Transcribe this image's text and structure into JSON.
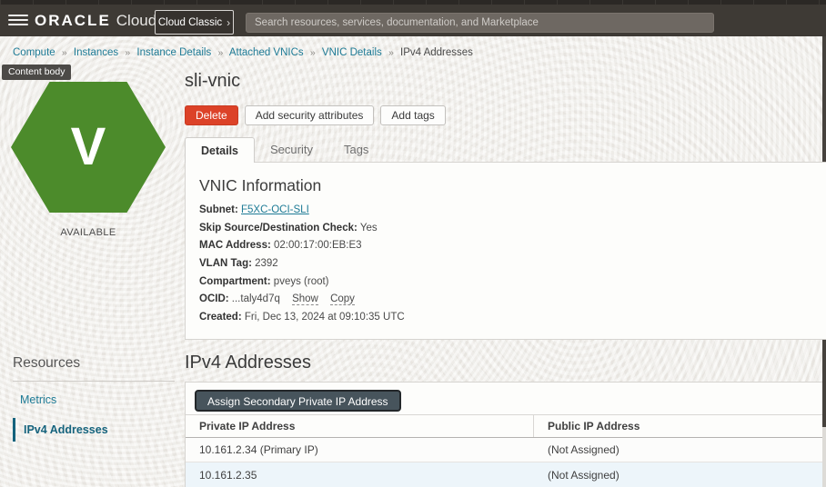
{
  "topbar": {
    "logo_oracle": "ORACLE",
    "logo_cloud": "Cloud",
    "classic_button": "Cloud Classic",
    "classic_chevron": "›",
    "search_placeholder": "Search resources, services, documentation, and Marketplace"
  },
  "breadcrumb": {
    "separator": "»",
    "items": [
      {
        "label": "Compute"
      },
      {
        "label": "Instances"
      },
      {
        "label": "Instance Details"
      },
      {
        "label": "Attached VNICs"
      },
      {
        "label": "VNIC Details"
      },
      {
        "label": "IPv4 Addresses"
      }
    ]
  },
  "tooltip": "Content body",
  "status": {
    "icon_letter": "V",
    "label": "AVAILABLE"
  },
  "page": {
    "title": "sli-vnic"
  },
  "actions": {
    "delete": "Delete",
    "add_security": "Add security attributes",
    "add_tags": "Add tags"
  },
  "tabs": [
    {
      "label": "Details"
    },
    {
      "label": "Security"
    },
    {
      "label": "Tags"
    }
  ],
  "vnic_info": {
    "heading": "VNIC Information",
    "fields": [
      {
        "label": "Subnet:",
        "value": "F5XC-OCI-SLI"
      },
      {
        "label": "Skip Source/Destination Check:",
        "value": "Yes"
      },
      {
        "label": "MAC Address:",
        "value": "02:00:17:00:EB:E3"
      },
      {
        "label": "VLAN Tag:",
        "value": "2392"
      },
      {
        "label": "Compartment:",
        "value": "pveys (root)"
      },
      {
        "label": "OCID:",
        "value": "...taly4d7q",
        "links": [
          "Show",
          "Copy"
        ]
      },
      {
        "label": "Created:",
        "value": "Fri, Dec 13, 2024 at 09:10:35 UTC"
      }
    ]
  },
  "resources": {
    "heading": "Resources",
    "items": [
      {
        "label": "Metrics"
      },
      {
        "label": "IPv4 Addresses"
      }
    ]
  },
  "ipv4": {
    "heading": "IPv4 Addresses",
    "assign_button": "Assign Secondary Private IP Address",
    "table": {
      "columns": [
        "Private IP Address",
        "Public IP Address"
      ],
      "rows": [
        {
          "private_ip": "10.161.2.34 (Primary IP)",
          "public_ip": "(Not Assigned)"
        },
        {
          "private_ip": "10.161.2.35",
          "public_ip": "(Not Assigned)"
        }
      ]
    }
  },
  "colors": {
    "topbar_bg": "#3e3a35",
    "accent_link": "#1e7b96",
    "status_green": "#4c8b2b",
    "delete_red": "#dc4228",
    "assign_button_bg": "#47545c",
    "row_hover_bg": "#edf5fa"
  }
}
